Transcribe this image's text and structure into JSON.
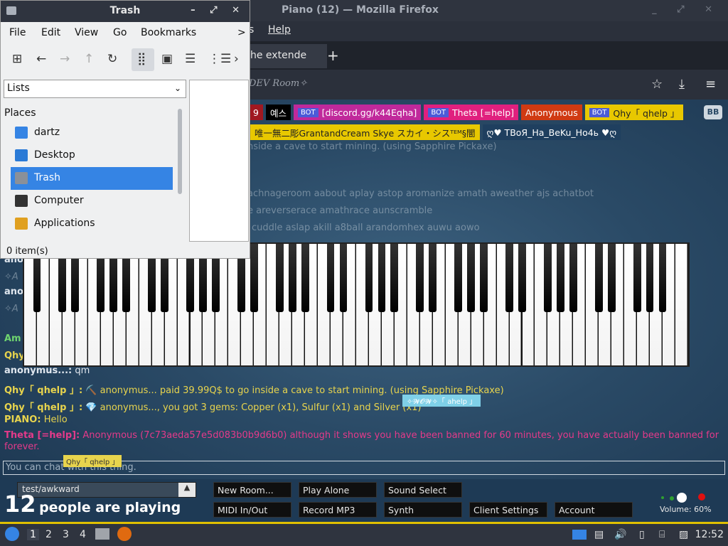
{
  "firefox": {
    "title": "Piano (12) — Mozilla Firefox",
    "menu_partial": "s",
    "menu_help": "Help",
    "tab_label": "he extende",
    "url": "DEV Room✧"
  },
  "userbar": {
    "row1": [
      {
        "label": "9",
        "bg": "#a01820",
        "bot": false
      },
      {
        "label": "예스",
        "bg": "#000000",
        "bot": false
      },
      {
        "label": "[discord.gg/k44Eqha]",
        "bg": "#c0299b",
        "bot": true
      },
      {
        "label": "Theta [=help]",
        "bg": "#e0207e",
        "bot": true
      },
      {
        "label": "Anonymous",
        "bg": "#d03a12",
        "bot": false
      },
      {
        "label": "Qhy「 qhelp 」",
        "bg": "#e8c800",
        "bot": true
      }
    ],
    "row2": [
      {
        "label": "唯一無二彫GrantandCream Skye スカイ・シスᵀᴱᴹ§闇",
        "bg": "#e8c800"
      },
      {
        "label": "ღ♥ TBoЯ_Ha_BeKu_Ho4ь ♥ღ",
        "bg": "#1f3f5f"
      }
    ],
    "sidebar_label": "BB",
    "bot_label": "BOT"
  },
  "chat": {
    "faded_lines": [
      "nside a cave to start mining. (using Sapphire Pickaxe)",
      "achnageroom aabout aplay astop aromanize amath aweather ajs achatbot",
      "e areverserace amathrace aunscramble",
      "cuddle aslap akill a8ball arandomhex auwu aowo"
    ],
    "left_fragments": [
      "ano",
      "✧A",
      "ano",
      "✧A",
      "Am",
      "Qhy"
    ],
    "lines": [
      {
        "name": "anonymus...:",
        "msg": "qm"
      },
      {
        "name": "Qhy「 qhelp 」:",
        "msg": "⛏️ anonymus... paid 39.99Q$ to go inside a cave to start mining. (using Sapphire Pickaxe)"
      },
      {
        "name": "Qhy「 qhelp 」:",
        "msg": "💎 anonymus..., you got 3 gems: Copper (x1), Sulfur (x1) and Silver (x1)"
      },
      {
        "name": "PIANO:",
        "msg": "Hello"
      }
    ],
    "theta_name": "Theta [=help]:",
    "theta_msg": "Anonymous (7c73aeda57e5d083b0b9d6b0) although it shows you have been banned for 60 minutes, you have actually been banned for",
    "theta_msg_2": "forever.",
    "input_placeholder": "You can chat with this thing.",
    "tooltip_qhy": "Qhy「 qhelp 」",
    "tooltip_bot": "✧𝓦𝓞𝓦✧「 ahelp 」"
  },
  "bottom": {
    "room": "test/awkward",
    "room_up": "▲",
    "count": "12",
    "count_text": "people are playing",
    "buttons": {
      "new_room": "New Room...",
      "play_alone": "Play Alone",
      "sound_select": "Sound Select",
      "midi": "MIDI In/Out",
      "record": "Record MP3",
      "synth": "Synth",
      "client_settings": "Client Settings",
      "account": "Account"
    },
    "volume": "Volume: 60%"
  },
  "file_manager": {
    "title": "Trash",
    "menu": [
      "File",
      "Edit",
      "View",
      "Go",
      "Bookmarks"
    ],
    "menu_more": ">",
    "view_select": "Lists",
    "places_label": "Places",
    "places": [
      {
        "label": "dartz",
        "color": "#3584e4"
      },
      {
        "label": "Desktop",
        "color": "#2a7ad6"
      },
      {
        "label": "Trash",
        "color": "#8a9099"
      },
      {
        "label": "Computer",
        "color": "#333333"
      },
      {
        "label": "Applications",
        "color": "#e0a020"
      }
    ],
    "status": "0 item(s)"
  },
  "taskbar": {
    "workspaces": [
      "1",
      "2",
      "3",
      "4"
    ],
    "clock": "12:52"
  }
}
